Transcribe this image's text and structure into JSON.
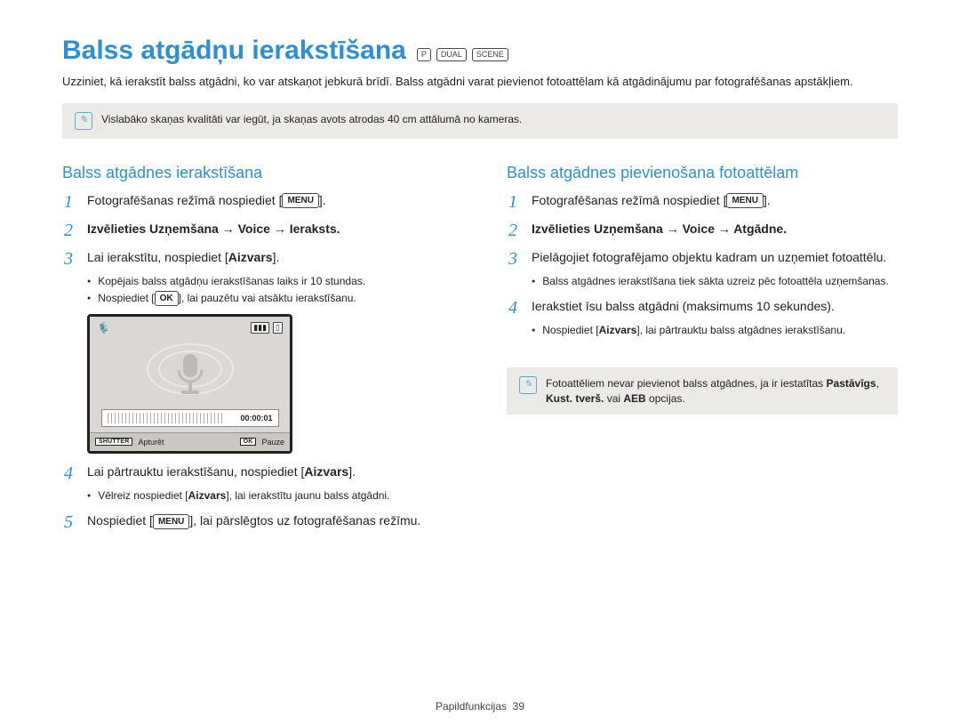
{
  "title": "Balss atgādņu ierakstīšana",
  "mode_icons": [
    "P",
    "DUAL",
    "SCENE"
  ],
  "intro": "Uzziniet, kā ierakstīt balss atgādni, ko var atskaņot jebkurā brīdī. Balss atgādni varat pievienot fotoattēlam kā atgādinājumu par fotografēšanas apstākļiem.",
  "note_top": "Vislabāko skaņas kvalitāti var iegūt, ja skaņas avots atrodas 40 cm attālumā no kameras.",
  "left": {
    "heading": "Balss atgādnes ierakstīšana",
    "steps": {
      "s1_a": "Fotografēšanas režīmā nospiediet [",
      "s1_btn": "MENU",
      "s1_b": "].",
      "s2": "Izvēlieties Uzņemšana → Voice → Ieraksts.",
      "s3": "Lai ierakstītu, nospiediet [Aizvars].",
      "s3_bullets": [
        "Kopējais balss atgādņu ierakstīšanas laiks ir 10 stundas.",
        "Nospiediet [ OK ], lai pauzētu vai atsāktu ierakstīšanu."
      ],
      "s4": "Lai pārtrauktu ierakstīšanu, nospiediet [Aizvars].",
      "s4_bullets": [
        "Vēlreiz nospiediet [Aizvars], lai ierakstītu jaunu balss atgādni."
      ],
      "s5_a": "Nospiediet [",
      "s5_btn": "MENU",
      "s5_b": "], lai pārslēgtos uz fotografēšanas režīmu."
    },
    "lcd": {
      "time": "00:00:01",
      "key_shutter": "SHUTTER",
      "lbl_stop": "Apturēt",
      "key_ok": "OK",
      "lbl_pause": "Pauze"
    }
  },
  "right": {
    "heading": "Balss atgādnes pievienošana fotoattēlam",
    "steps": {
      "s1_a": "Fotografēšanas režīmā nospiediet [",
      "s1_btn": "MENU",
      "s1_b": "].",
      "s2": "Izvēlieties Uzņemšana → Voice → Atgādne.",
      "s3": "Pielāgojiet fotografējamo objektu kadram un uzņemiet fotoattēlu.",
      "s3_bullets": [
        "Balss atgādnes ierakstīšana tiek sākta uzreiz pēc fotoattēla uzņemšanas."
      ],
      "s4": "Ierakstiet īsu balss atgādni (maksimums 10 sekundes).",
      "s4_bullets": [
        "Nospiediet [Aizvars], lai pārtrauktu balss atgādnes ierakstīšanu."
      ]
    },
    "note_bottom": "Fotoattēliem nevar pievienot balss atgādnes, ja ir iestatītas Pastāvīgs, Kust. tverš. vai AEB opcijas."
  },
  "footer_label": "Papildfunkcijas",
  "footer_page": "39"
}
